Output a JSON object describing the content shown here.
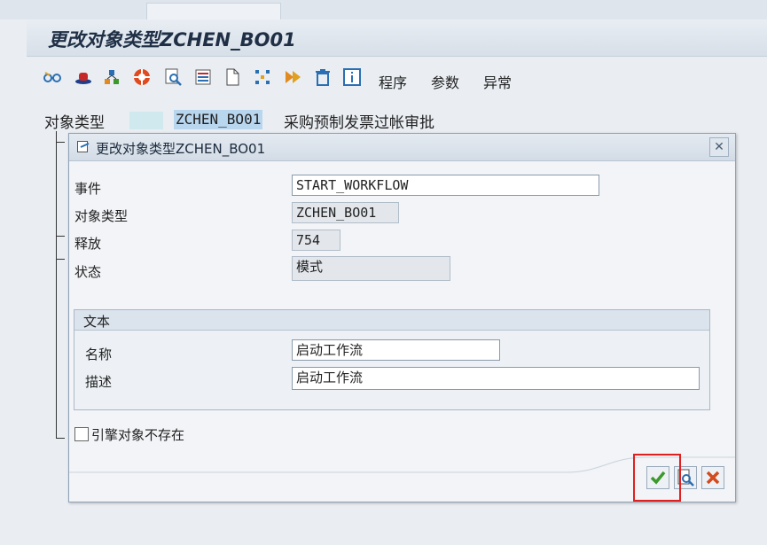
{
  "window": {
    "title": "更改对象类型ZCHEN_BO01"
  },
  "toolbar": {
    "icons": [
      "glasses-icon",
      "hat-icon",
      "tree-icon",
      "lifebuoy-icon",
      "search-doc-icon",
      "list-icon",
      "new-doc-icon",
      "grid-dots-icon",
      "play-forward-icon",
      "trash-icon",
      "info-icon"
    ],
    "menu_program": "程序",
    "menu_parameters": "参数",
    "menu_exceptions": "异常"
  },
  "object_header": {
    "label": "对象类型",
    "value": "ZCHEN_BO01",
    "description": "采购预制发票过帐审批"
  },
  "dialog": {
    "title": "更改对象类型ZCHEN_BO01",
    "fields": {
      "event_label": "事件",
      "event_value": "START_WORKFLOW",
      "object_type_label": "对象类型",
      "object_type_value": "ZCHEN_BO01",
      "release_label": "释放",
      "release_value": "754",
      "status_label": "状态",
      "status_value": "模式"
    },
    "text_group": {
      "title": "文本",
      "name_label": "名称",
      "name_value": "启动工作流",
      "desc_label": "描述",
      "desc_value": "启动工作流"
    },
    "checkbox_label": "引擎对象不存在",
    "checkbox_checked": false,
    "buttons": {
      "confirm_icon": "checkmark-icon",
      "check_icon": "search-doc-icon",
      "cancel_icon": "cross-icon"
    }
  },
  "colors": {
    "highlight": "#b9d6ef",
    "confirm_green": "#3c9a2a",
    "cancel_red": "#d24a1e",
    "annotation_red": "#e02020"
  }
}
